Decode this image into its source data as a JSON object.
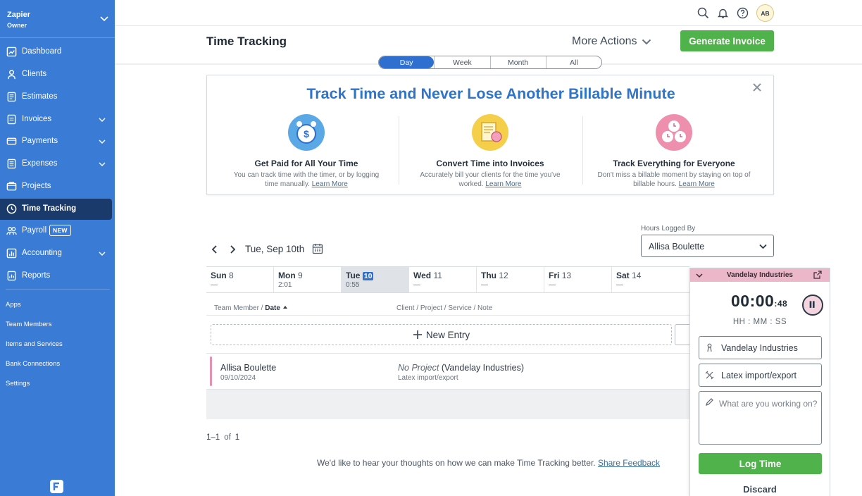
{
  "sidebar": {
    "org_name": "Zapier",
    "org_role": "Owner",
    "items": [
      {
        "label": "Dashboard",
        "icon": "dashboard-icon"
      },
      {
        "label": "Clients",
        "icon": "clients-icon"
      },
      {
        "label": "Estimates",
        "icon": "estimates-icon"
      },
      {
        "label": "Invoices",
        "icon": "invoices-icon"
      },
      {
        "label": "Payments",
        "icon": "payments-icon"
      },
      {
        "label": "Expenses",
        "icon": "expenses-icon"
      },
      {
        "label": "Projects",
        "icon": "projects-icon"
      },
      {
        "label": "Time Tracking",
        "icon": "clock-icon"
      },
      {
        "label": "Payroll",
        "icon": "payroll-icon",
        "badge": "NEW"
      },
      {
        "label": "Accounting",
        "icon": "accounting-icon"
      },
      {
        "label": "Reports",
        "icon": "reports-icon"
      }
    ],
    "secondary": [
      {
        "label": "Apps"
      },
      {
        "label": "Team Members"
      },
      {
        "label": "Items and Services"
      },
      {
        "label": "Bank Connections"
      },
      {
        "label": "Settings"
      }
    ],
    "active_item": "Time Tracking"
  },
  "topbar": {
    "avatar_initials": "AB"
  },
  "header": {
    "title": "Time Tracking",
    "more_actions": "More Actions",
    "generate_invoice": "Generate Invoice"
  },
  "view_tabs": {
    "items": [
      "Day",
      "Week",
      "Month",
      "All"
    ],
    "active": "Day"
  },
  "promo": {
    "title": "Track Time and Never Lose Another Billable Minute",
    "learn_more": "Learn More",
    "columns": [
      {
        "heading": "Get Paid for All Your Time",
        "text": "You can track time with the timer, or by logging time manually."
      },
      {
        "heading": "Convert Time into Invoices",
        "text": "Accurately bill your clients for the time you've worked."
      },
      {
        "heading": "Track Everything for Everyone",
        "text": "Don't miss a billable moment by staying on top of billable hours."
      }
    ]
  },
  "date_nav": {
    "current_date": "Tue, Sep 10th"
  },
  "hours_logged_by": {
    "label": "Hours Logged By",
    "value": "Allisa Boulette"
  },
  "week": [
    {
      "name": "Sun",
      "num": "8",
      "value": "—"
    },
    {
      "name": "Mon",
      "num": "9",
      "value": "2:01"
    },
    {
      "name": "Tue",
      "num": "10",
      "value": "0:55",
      "selected": true
    },
    {
      "name": "Wed",
      "num": "11",
      "value": "—"
    },
    {
      "name": "Thu",
      "num": "12",
      "value": "—"
    },
    {
      "name": "Fri",
      "num": "13",
      "value": "—"
    },
    {
      "name": "Sat",
      "num": "14",
      "value": "—"
    }
  ],
  "table": {
    "col_left_a": "Team Member",
    "col_left_b": "Date",
    "col_right": "Client / Project / Service / Note",
    "new_entry": "New Entry",
    "entries": [
      {
        "member": "Allisa Boulette",
        "date": "09/10/2024",
        "project": "No Project",
        "client": "(Vandelay Industries)",
        "service": "Latex import/export"
      }
    ]
  },
  "pagination": {
    "start": "1–1",
    "of": "of",
    "total": "1"
  },
  "feedback": {
    "text": "We'd like to hear your thoughts on how we can make Time Tracking better.",
    "link": "Share Feedback"
  },
  "timer": {
    "client_title": "Vandelay Industries",
    "time_main": "00:00",
    "time_seconds": ":48",
    "format": "HH : MM : SS",
    "client_value": "Vandelay Industries",
    "service_value": "Latex import/export",
    "note_placeholder": "What are you working on?",
    "log_time": "Log Time",
    "discard": "Discard"
  },
  "colors": {
    "sidebar": "#3a7bd5",
    "active_nav": "#1a3a6b",
    "primary_green": "#4fb24a",
    "accent_blue": "#2f6fcf",
    "timer_header": "#ecb7c8"
  }
}
